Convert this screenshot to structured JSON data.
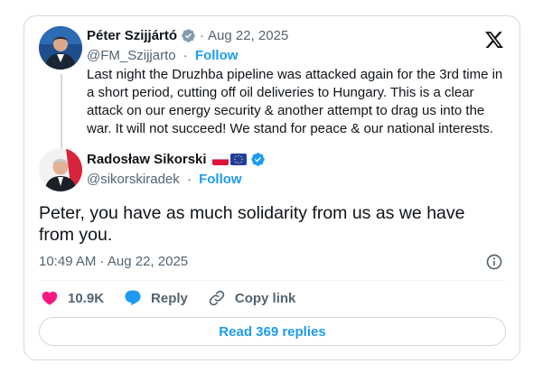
{
  "brand_icon": "x-logo-icon",
  "quoted": {
    "name": "Péter Szijjártó",
    "verified_icon": "verified-gray-badge-icon",
    "date": "Aug 22, 2025",
    "handle": "@FM_Szijjarto",
    "follow_label": "Follow",
    "text": "Last night the Druzhba pipeline was attacked again for the 3rd time in a short period, cutting off oil deliveries to Hungary. This is a clear attack on our energy security & another attempt to drag us into the war. It will not succeed! We stand for peace & our national interests."
  },
  "reply": {
    "name": "Radosław Sikorski",
    "flags": [
      "poland-flag-icon",
      "eu-flag-icon"
    ],
    "verified_icon": "verified-blue-badge-icon",
    "handle": "@sikorskiradek",
    "follow_label": "Follow",
    "text": "Peter, you have as much solidarity from us as we have from you.",
    "timestamp": "10:49 AM · Aug 22, 2025"
  },
  "actions": {
    "likes": "10.9K",
    "reply_label": "Reply",
    "copy_label": "Copy link"
  },
  "read_replies_label": "Read 369 replies",
  "colors": {
    "accent": "#1d9bf0",
    "like": "#f91880",
    "muted": "#536471",
    "border": "#cfd9de"
  }
}
